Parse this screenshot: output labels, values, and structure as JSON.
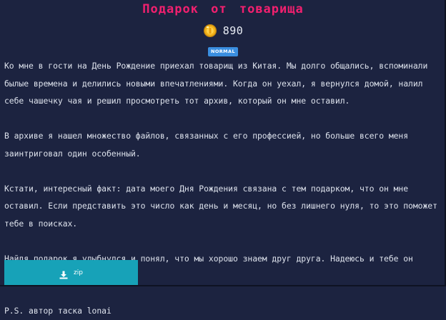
{
  "challenge": {
    "title": "Подарок от товарища",
    "points": "890",
    "difficulty": "NORMAL",
    "description": [
      "Ко мне в гости на День Рождение приехал товарищ из Китая. Мы долго общались, вспоминали былые времена и делились новыми впечатлениями. Когда он уехал, я вернулся домой, налил себе чашечку чая и решил просмотреть тот архив, который он мне оставил.",
      "В архиве я нашел множество файлов, связанных с его профессией, но больше всего меня заинтриговал один особенный.",
      "Кстати, интересный факт: дата моего Дня Рождения связана с тем подарком, что он мне оставил. Если представить это число как день и месяц, но без лишнего нуля, то это поможет тебе в поисках.",
      "Найдя подарок я улыбнулся и понял, что мы хорошо знаем друг друга. Надеюсь и тебе он понравится!",
      "P.S. автор таска lonai"
    ],
    "attachment_label": "zip"
  },
  "icons": {
    "points": "coin-icon",
    "download": "download-icon"
  },
  "colors": {
    "background": "#1c2340",
    "title": "#f2206f",
    "badge": "#3a8ee0",
    "button": "#17a2b8",
    "coin": "#f2b21a"
  }
}
